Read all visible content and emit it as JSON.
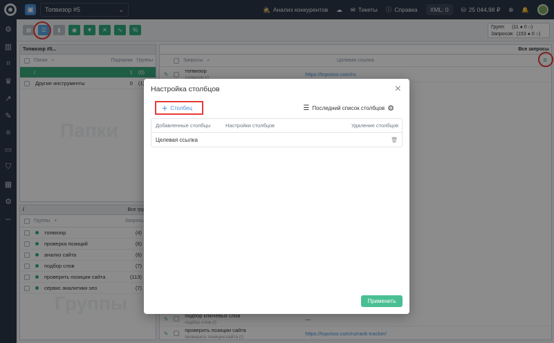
{
  "topbar": {
    "project": "Топвизор #5",
    "competitors": "Анализ конкурентов",
    "tickets": "Тикеты",
    "help": "Справка",
    "xml": "XML: 0",
    "balance": "25 044,98 ₽"
  },
  "stats": {
    "groups_label": "Групп:",
    "groups_value": "(11 ● 0 ○)",
    "queries_label": "Запросов:",
    "queries_value": "(153 ● 0 ○)"
  },
  "folders": {
    "tab": "Топвизор #5...",
    "col_folders": "Папки",
    "col_sub": "Подпапки",
    "col_groups": "Группы",
    "root": "/",
    "root_sub": "1",
    "root_groups": "(0)",
    "item": "Другие инструменты",
    "item_sub": "0",
    "item_groups": "(1)",
    "ghost": "Папки"
  },
  "groups": {
    "path": "/",
    "all_groups": "Все группы",
    "col_groups": "Группы",
    "col_queries": "Запросы",
    "items": [
      {
        "name": "топвизор",
        "count": "(4)"
      },
      {
        "name": "проверка позиций",
        "count": "(6)"
      },
      {
        "name": "анализ сайта",
        "count": "(6)"
      },
      {
        "name": "подбор слов",
        "count": "(7)"
      },
      {
        "name": "проверить позиции сайта",
        "count": "(113)"
      },
      {
        "name": "сервис аналитики seo",
        "count": "(7)"
      }
    ],
    "ghost": "Группы"
  },
  "queries": {
    "all_queries": "Все запросы",
    "col_queries": "Запросы",
    "col_target": "Целевая ссылка",
    "top": {
      "q": "топвизор",
      "sub": "топвизор (/)",
      "url": "https://topvisor.com/ru"
    },
    "bottom": [
      {
        "q": "подбор ключевых слов",
        "sub": "подбор слов (/)",
        "url": "—"
      },
      {
        "q": "проверить позиции сайта",
        "sub": "проверить позиции сайта (/)",
        "url": "https://topvisor.com/ru/rank-tracker/"
      }
    ]
  },
  "modal": {
    "title": "Настройка столбцов",
    "add_column": "Столбец",
    "last_list": "Последний список столбцов",
    "col_added": "Добавленные столбцы",
    "col_settings": "Настройки столбцов",
    "col_delete": "Удаление столбцов",
    "row_name": "Целевая ссылка",
    "apply": "Применить"
  }
}
